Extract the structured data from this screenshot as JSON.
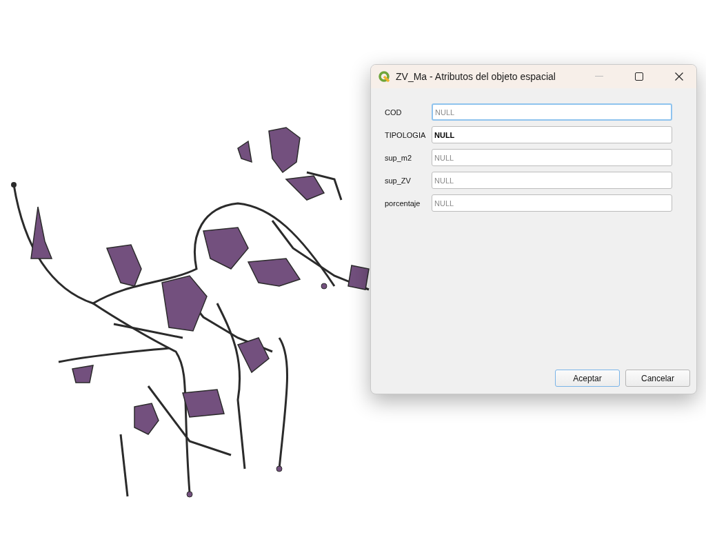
{
  "window": {
    "title": "ZV_Ma - Atributos del objeto espacial"
  },
  "fields": [
    {
      "label": "COD",
      "placeholder": "NULL",
      "focused": true
    },
    {
      "label": "TIPOLOGIA",
      "value": "NULL",
      "focused": false
    },
    {
      "label": "sup_m2",
      "placeholder": "NULL",
      "focused": false
    },
    {
      "label": "sup_ZV",
      "placeholder": "NULL",
      "focused": false
    },
    {
      "label": "porcentaje",
      "placeholder": "NULL",
      "focused": false
    }
  ],
  "buttons": [
    {
      "label": "Aceptar",
      "default": true
    },
    {
      "label": "Cancelar",
      "default": false
    }
  ]
}
